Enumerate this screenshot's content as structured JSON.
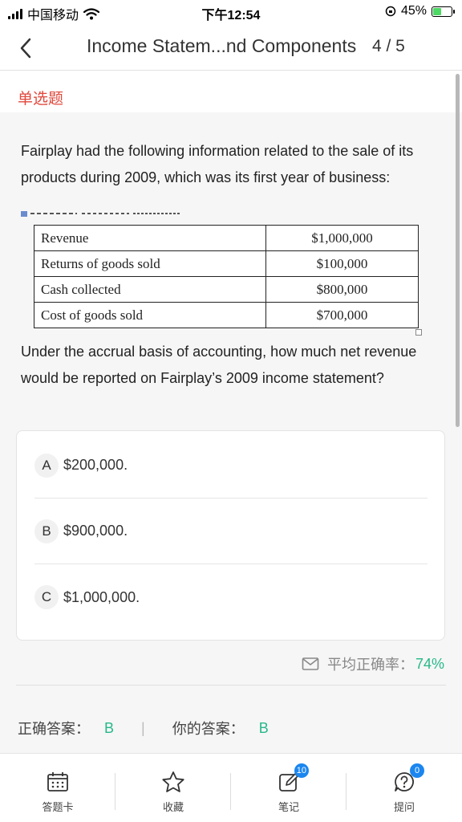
{
  "status_bar": {
    "carrier": "中国移动",
    "time": "下午12:54",
    "battery_pct": "45%",
    "battery_level": 0.45
  },
  "nav": {
    "title": "Income Statem...nd Components",
    "progress": "4 / 5"
  },
  "question": {
    "type": "单选题",
    "text_1": "Fairplay had the following information related to the sale of its products during 2009, which was its first year of business:",
    "table": [
      {
        "label": "Revenue",
        "value": "$1,000,000"
      },
      {
        "label": "Returns of goods sold",
        "value": "$100,000"
      },
      {
        "label": "Cash collected",
        "value": "$800,000"
      },
      {
        "label": "Cost of goods sold",
        "value": "$700,000"
      }
    ],
    "text_2": "Under the accrual basis of accounting, how much net revenue would be reported on Fairplay’s 2009 income statement?"
  },
  "options": [
    {
      "letter": "A",
      "text": "$200,000."
    },
    {
      "letter": "B",
      "text": "$900,000."
    },
    {
      "letter": "C",
      "text": "$1,000,000."
    }
  ],
  "stats": {
    "accuracy_label": "平均正确率：",
    "accuracy_value": "74%"
  },
  "answers": {
    "correct_label": "正确答案：",
    "correct_value": "B",
    "separator": "|",
    "yours_label": "你的答案：",
    "yours_value": "B"
  },
  "tabs": [
    {
      "label": "答题卡",
      "icon": "answer-card-icon"
    },
    {
      "label": "收藏",
      "icon": "star-icon"
    },
    {
      "label": "笔记",
      "icon": "note-icon",
      "badge": "10"
    },
    {
      "label": "提问",
      "icon": "question-icon",
      "badge": "0"
    }
  ],
  "colors": {
    "accent_green": "#27b88a",
    "type_red": "#e0483c",
    "badge_blue": "#1b86ef"
  }
}
